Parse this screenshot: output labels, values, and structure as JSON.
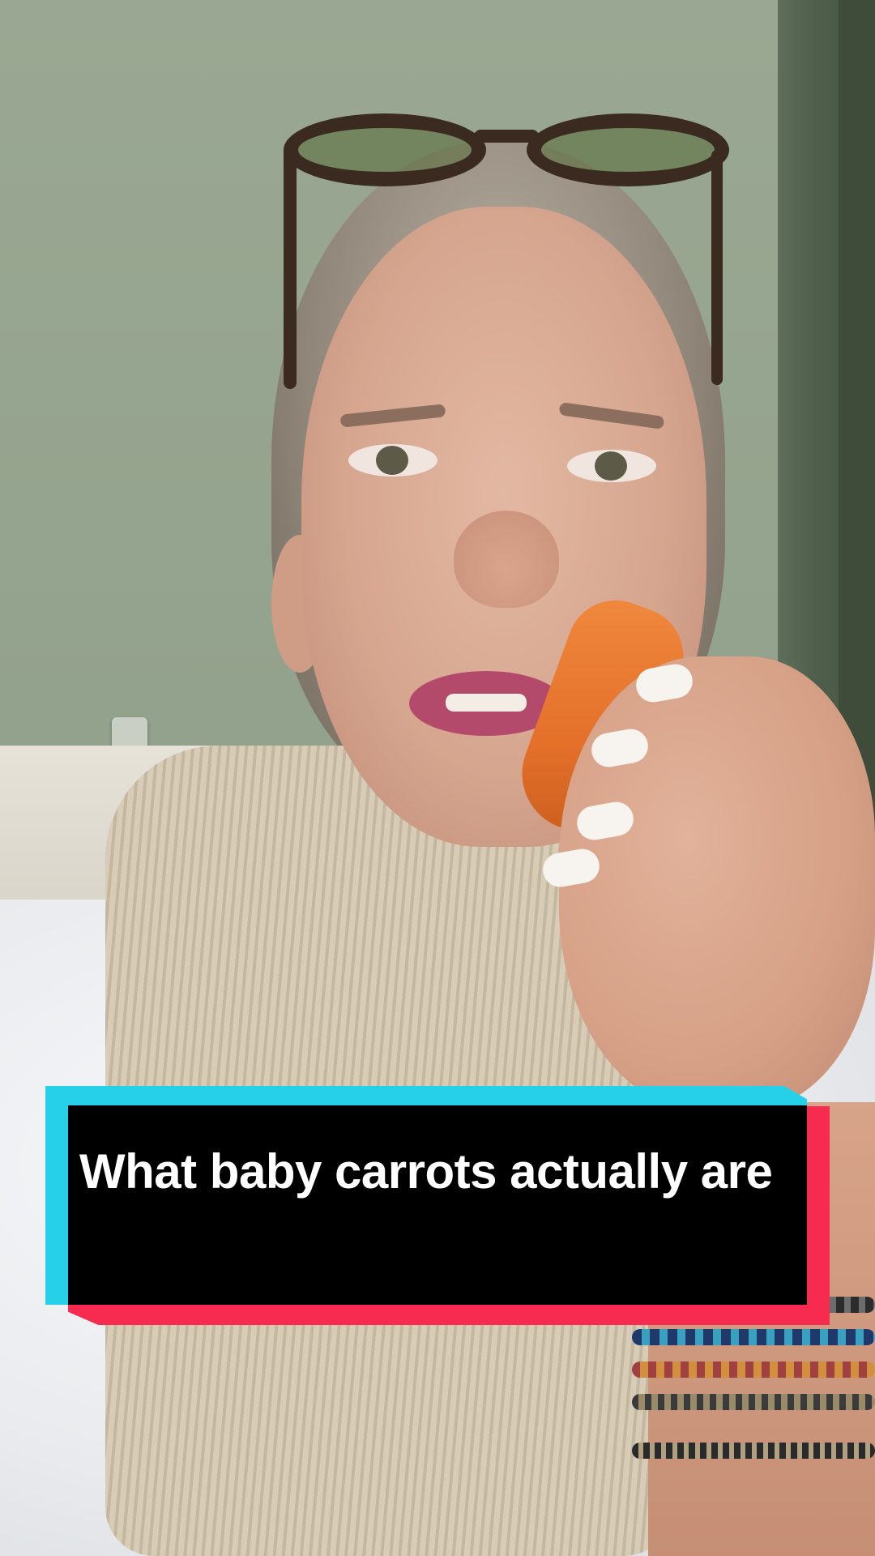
{
  "video": {
    "caption": "What baby carrots actually are",
    "caption_colors": {
      "box": "#000000",
      "text": "#ffffff",
      "accent_left": "#25d0e8",
      "accent_right": "#f72b4f"
    }
  }
}
